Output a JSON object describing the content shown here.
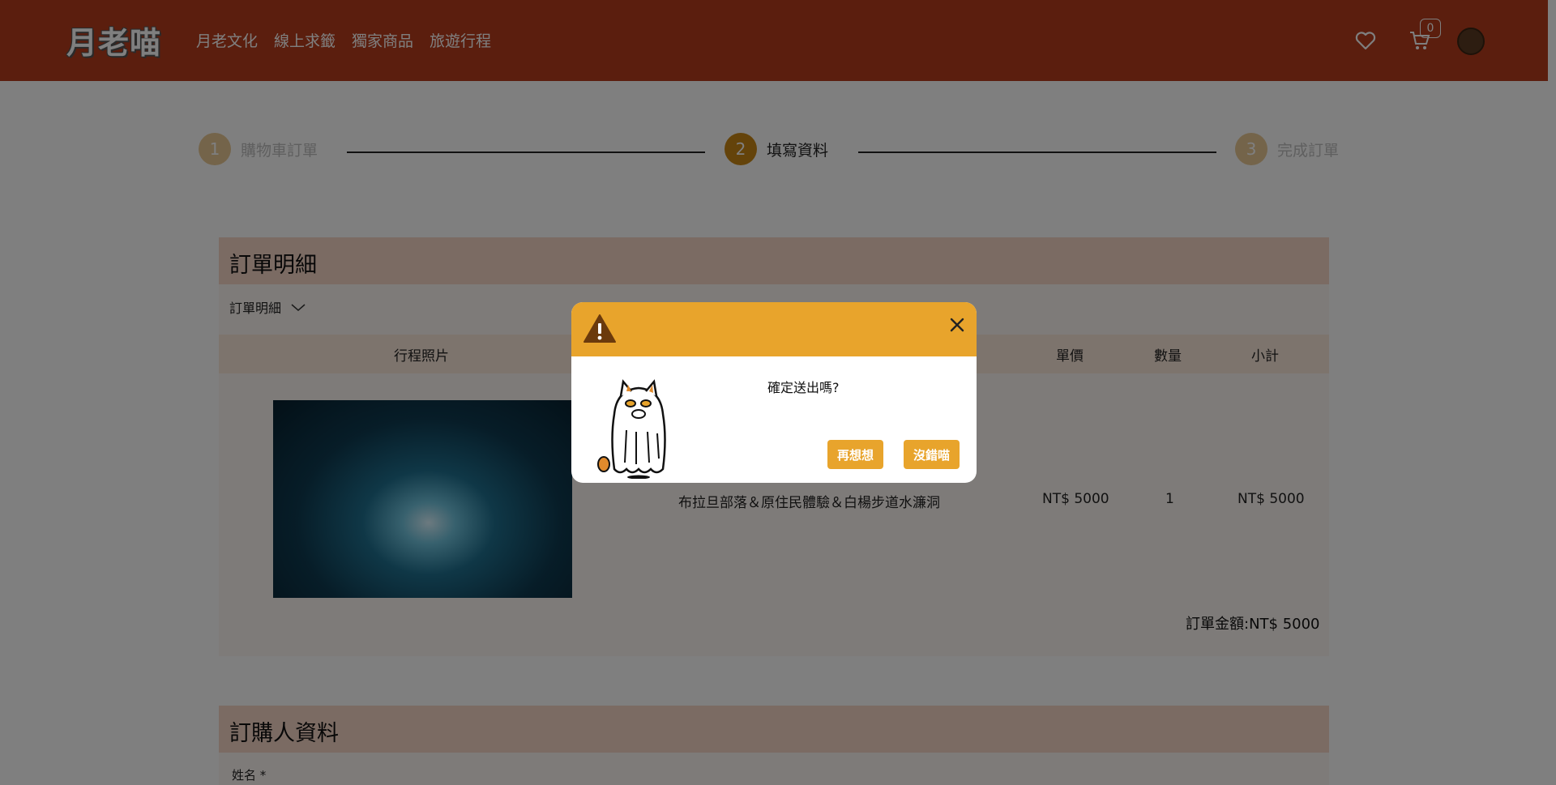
{
  "header": {
    "logo": "月老喵",
    "nav": [
      "月老文化",
      "線上求籤",
      "獨家商品",
      "旅遊行程"
    ],
    "cart_count": "0"
  },
  "stepper": {
    "steps": [
      {
        "num": "1",
        "label": "購物車訂單"
      },
      {
        "num": "2",
        "label": "填寫資料"
      },
      {
        "num": "3",
        "label": "完成訂單"
      }
    ]
  },
  "order_section": {
    "title": "訂單明細",
    "toggle_label": "訂單明細",
    "columns": {
      "photo": "行程照片",
      "unit_price": "單價",
      "qty": "數量",
      "subtotal": "小計"
    },
    "items": [
      {
        "name": "布拉旦部落＆原住民體驗＆白楊步道水濂洞",
        "unit_price": "NT$ 5000",
        "qty": "1",
        "subtotal": "NT$ 5000"
      }
    ],
    "total": "訂單金額:NT$ 5000"
  },
  "buyer_section": {
    "title": "訂購人資料",
    "name_label": "姓名 *"
  },
  "modal": {
    "message": "確定送出嗎?",
    "cancel_label": "再想想",
    "confirm_label": "沒錯喵"
  },
  "colors": {
    "header": "#b73d1c",
    "accent": "#e8a42c",
    "section_head": "#f6d6c6"
  },
  "icons": [
    "heart-icon",
    "cart-icon",
    "avatar",
    "warning-icon",
    "close-icon",
    "chevron-down-icon"
  ]
}
